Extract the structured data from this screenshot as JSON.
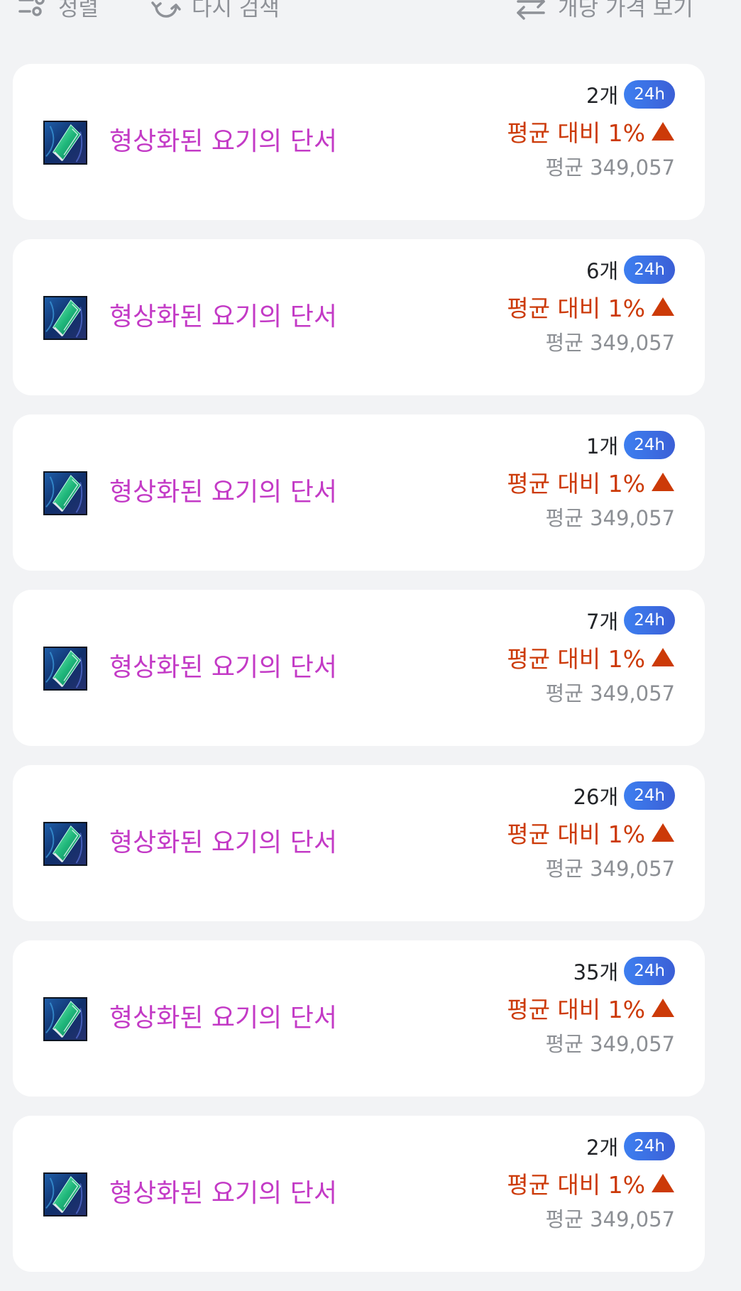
{
  "toolbar": {
    "sort_label": "정렬",
    "research_label": "다시 검색",
    "unit_price_label": "개당 가격 보기"
  },
  "colors": {
    "item_name": "#c33ac6",
    "change_up": "#cc3a08",
    "badge": "#3b6fe4",
    "background": "#f2f3f5"
  },
  "items": [
    {
      "name": "형상화된 요기의 단서",
      "icon": "shard-icon",
      "count": "2개",
      "badge": "24h",
      "change": "평균 대비 1%",
      "trend": "up-triangle-icon",
      "average": "평균 349,057"
    },
    {
      "name": "형상화된 요기의 단서",
      "icon": "shard-icon",
      "count": "6개",
      "badge": "24h",
      "change": "평균 대비 1%",
      "trend": "up-triangle-icon",
      "average": "평균 349,057"
    },
    {
      "name": "형상화된 요기의 단서",
      "icon": "shard-icon",
      "count": "1개",
      "badge": "24h",
      "change": "평균 대비 1%",
      "trend": "up-triangle-icon",
      "average": "평균 349,057"
    },
    {
      "name": "형상화된 요기의 단서",
      "icon": "shard-icon",
      "count": "7개",
      "badge": "24h",
      "change": "평균 대비 1%",
      "trend": "up-triangle-icon",
      "average": "평균 349,057"
    },
    {
      "name": "형상화된 요기의 단서",
      "icon": "shard-icon",
      "count": "26개",
      "badge": "24h",
      "change": "평균 대비 1%",
      "trend": "up-triangle-icon",
      "average": "평균 349,057"
    },
    {
      "name": "형상화된 요기의 단서",
      "icon": "shard-icon",
      "count": "35개",
      "badge": "24h",
      "change": "평균 대비 1%",
      "trend": "up-triangle-icon",
      "average": "평균 349,057"
    },
    {
      "name": "형상화된 요기의 단서",
      "icon": "shard-icon",
      "count": "2개",
      "badge": "24h",
      "change": "평균 대비 1%",
      "trend": "up-triangle-icon",
      "average": "평균 349,057"
    }
  ]
}
